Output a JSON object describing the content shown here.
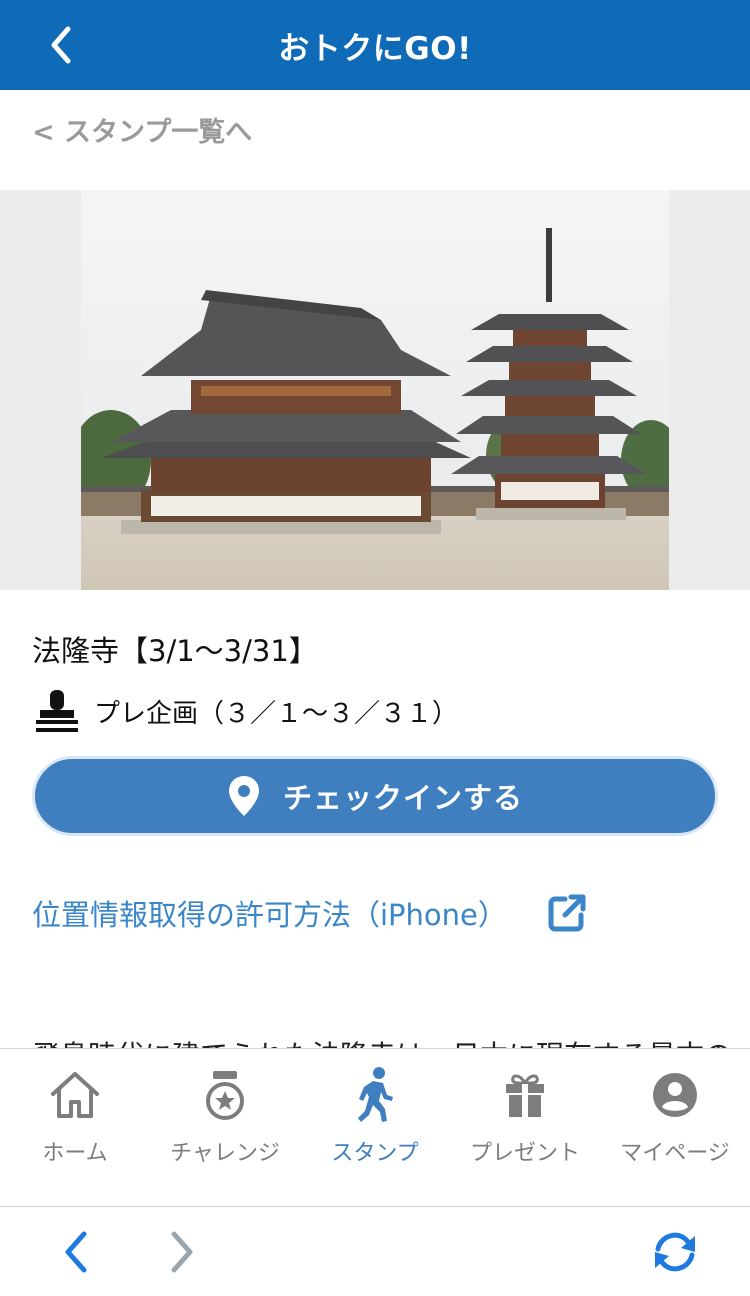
{
  "header": {
    "title": "おトクにGO!"
  },
  "breadcrumb": {
    "label": "< スタンプ一覧へ"
  },
  "spot": {
    "title": "法隆寺【3/1〜3/31】",
    "campaign": "プレ企画（３／１〜３／３１）"
  },
  "checkin": {
    "label": "チェックインする"
  },
  "permit_link": {
    "label": "位置情報取得の許可方法（iPhone）"
  },
  "description": {
    "text": "飛鳥時代に建てられた法隆寺は、日本に現存する最古の木"
  },
  "tabbar": {
    "items": [
      {
        "label": "ホーム",
        "icon": "home-icon"
      },
      {
        "label": "チャレンジ",
        "icon": "medal-icon"
      },
      {
        "label": "スタンプ",
        "icon": "walking-icon",
        "active": true
      },
      {
        "label": "プレゼント",
        "icon": "gift-icon"
      },
      {
        "label": "マイページ",
        "icon": "user-icon"
      }
    ]
  },
  "colors": {
    "header": "#0f6bb8",
    "accent": "#3f7fbf",
    "link": "#3a86c8",
    "browser_blue": "#1f7ae0"
  }
}
